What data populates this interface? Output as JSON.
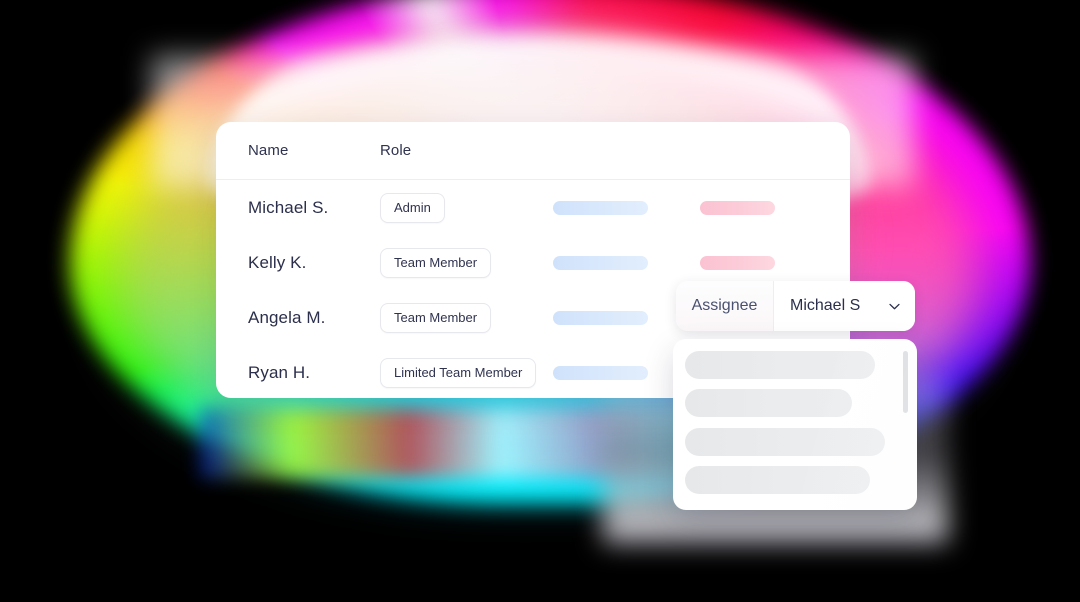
{
  "background": {
    "description": "blurred multicolor halo backdrop",
    "colors": [
      "#00f0ff",
      "#8cf000",
      "#e8ff00",
      "#ff3b00",
      "#ff0044",
      "#ff00e0",
      "#8c00ff",
      "#0033ff"
    ]
  },
  "table": {
    "columns": [
      "Name",
      "Role"
    ],
    "rows": [
      {
        "name": "Michael S.",
        "role": "Admin",
        "bar_blue": true,
        "bar_pink": true
      },
      {
        "name": "Kelly K.",
        "role": "Team Member",
        "bar_blue": true,
        "bar_pink": true
      },
      {
        "name": "Angela M.",
        "role": "Team Member",
        "bar_blue": true,
        "bar_pink": false
      },
      {
        "name": "Ryan H.",
        "role": "Limited Team Member",
        "bar_blue": true,
        "bar_pink": false
      }
    ],
    "colors": {
      "text": "#2b2f4c",
      "header_text": "#2f3350",
      "badge_border": "#e6e8ee",
      "bar_blue": "#d6e6fa",
      "bar_pink": "#fbc9d4",
      "card_bg": "#ffffff"
    }
  },
  "assignee": {
    "label": "Assignee",
    "value": "Michael S",
    "chevron_icon": "chevron-down-icon"
  },
  "dropdown": {
    "items": [
      {
        "placeholder_width": 190
      },
      {
        "placeholder_width": 167
      },
      {
        "placeholder_width": 200
      },
      {
        "placeholder_width": 185
      }
    ],
    "scrollbar_visible": true,
    "item_color": "#e8eaec"
  }
}
